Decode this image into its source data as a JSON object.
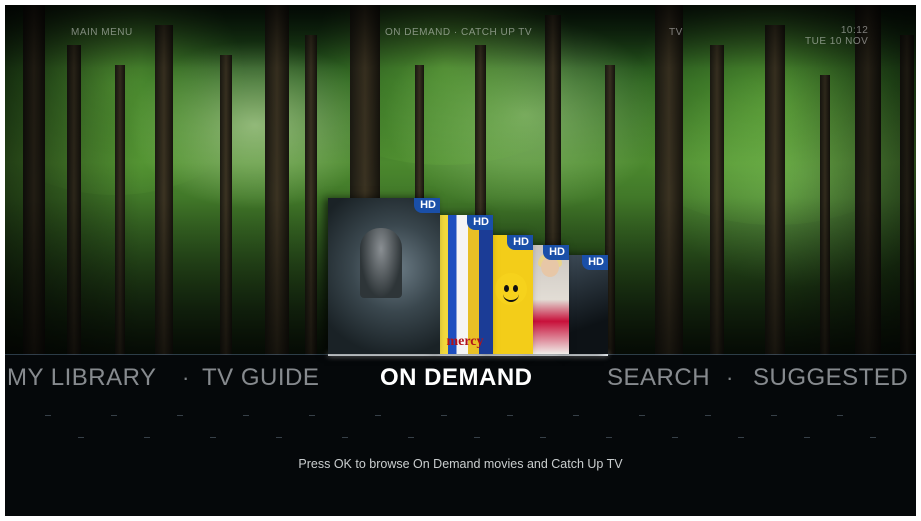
{
  "topbar": {
    "left": "MAIN MENU",
    "center": "ON DEMAND · CATCH UP TV",
    "right_short": "TV",
    "right_time": "10:12",
    "right_date": "TUE 10 NOV"
  },
  "posters": [
    {
      "badge": "HD",
      "art": "jurassic-world"
    },
    {
      "badge": "HD",
      "word": "mercy"
    },
    {
      "badge": "HD",
      "art": "lego-face"
    },
    {
      "badge": "HD",
      "art": "woman-portrait"
    },
    {
      "badge": "HD",
      "art": "dark-figure"
    }
  ],
  "menu": {
    "items": [
      "MY LIBRARY",
      "TV GUIDE",
      "ON DEMAND",
      "SEARCH",
      "SUGGESTED"
    ],
    "separator": "·",
    "selected": "ON DEMAND"
  },
  "hint": "Press OK to browse On Demand movies and Catch Up TV",
  "colors": {
    "hd_badge": "#1a4fa8",
    "selected_text": "#ffffff",
    "menu_text": "#dce1e6"
  }
}
